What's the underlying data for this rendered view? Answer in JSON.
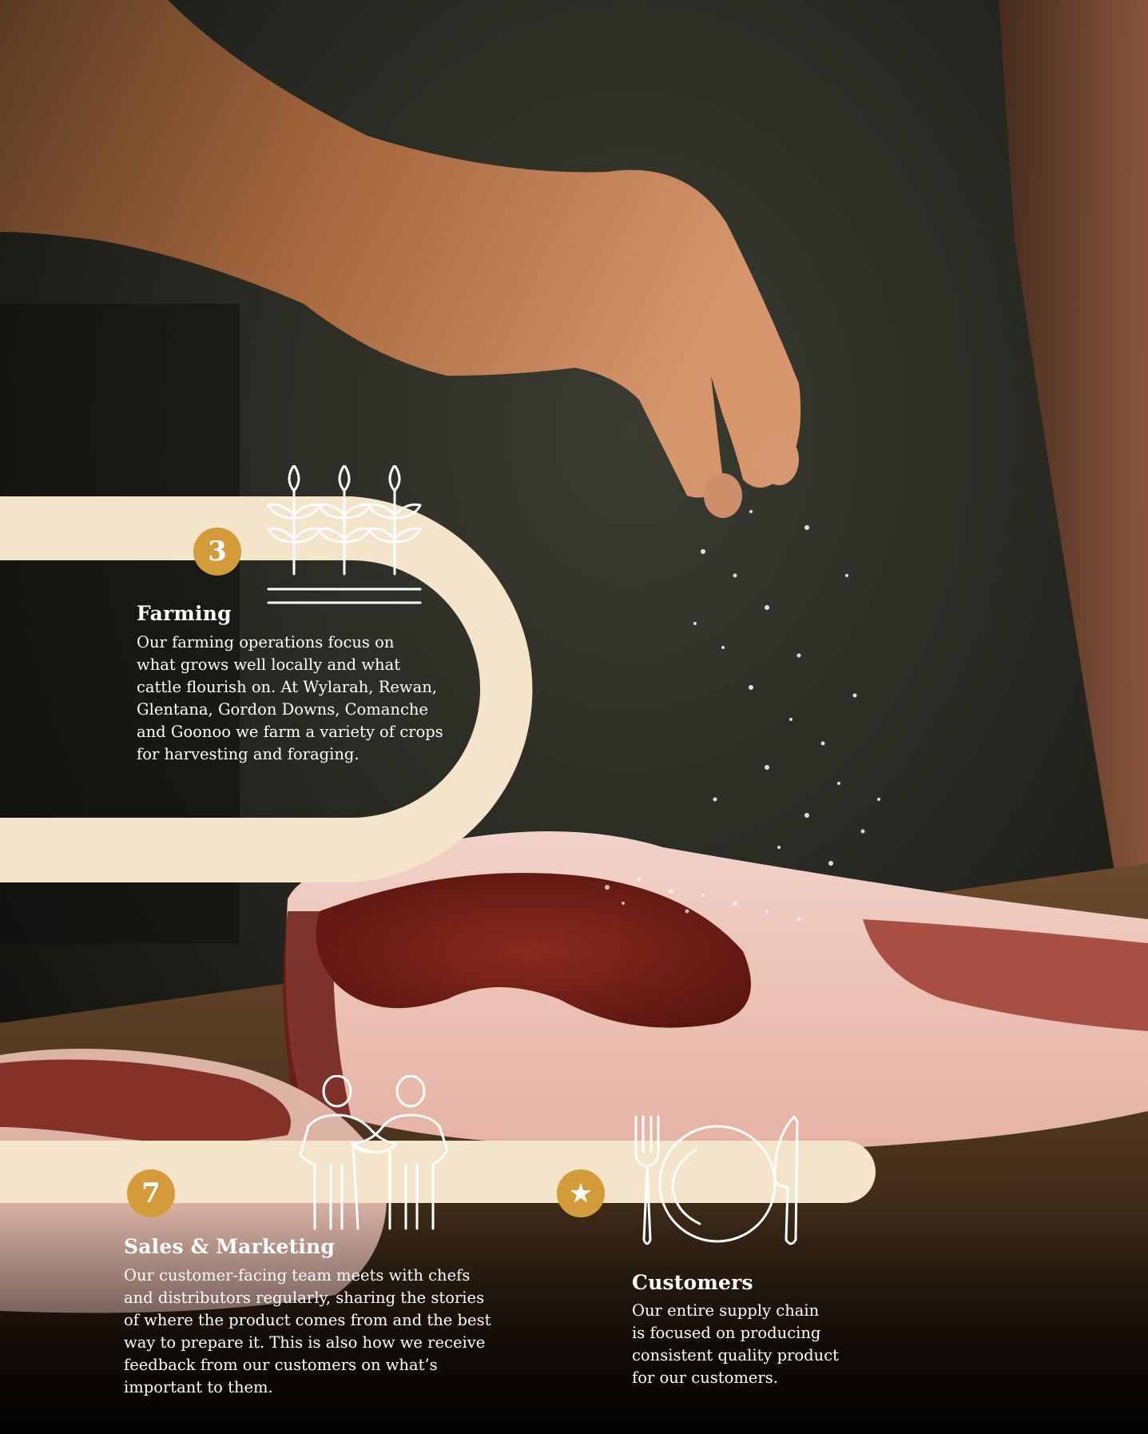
{
  "colors": {
    "band": "#f4e4c9",
    "badge": "#d49b3a",
    "icon_stroke": "#ffffff",
    "background": "#0d0c0a"
  },
  "photo": {
    "subject": "hand-sprinkling-salt-on-raw-steak-photo"
  },
  "steps": [
    {
      "number": "3",
      "title": "Farming",
      "body": "Our farming operations focus on\nwhat grows well locally and what\n cattle flourish on. At Wylarah, Rewan,\nGlentana, Gordon Downs, Comanche\nand Goonoo we farm a variety of crops\nfor harvesting and foraging.",
      "icon": "wheat-icon"
    },
    {
      "number": "7",
      "title": "Sales & Marketing",
      "body": "Our customer-facing team meets with chefs\nand distributors regularly, sharing the stories\nof where the product comes from and the best\nway to prepare it. This is also how we receive\nfeedback from our customers on what’s\nimportant to them.",
      "icon": "handshake-icon"
    },
    {
      "number": "★",
      "title": "Customers",
      "body": "Our entire supply chain\nis focused on producing\nconsistent quality product\nfor our customers.",
      "icon": "dining-icon"
    }
  ]
}
